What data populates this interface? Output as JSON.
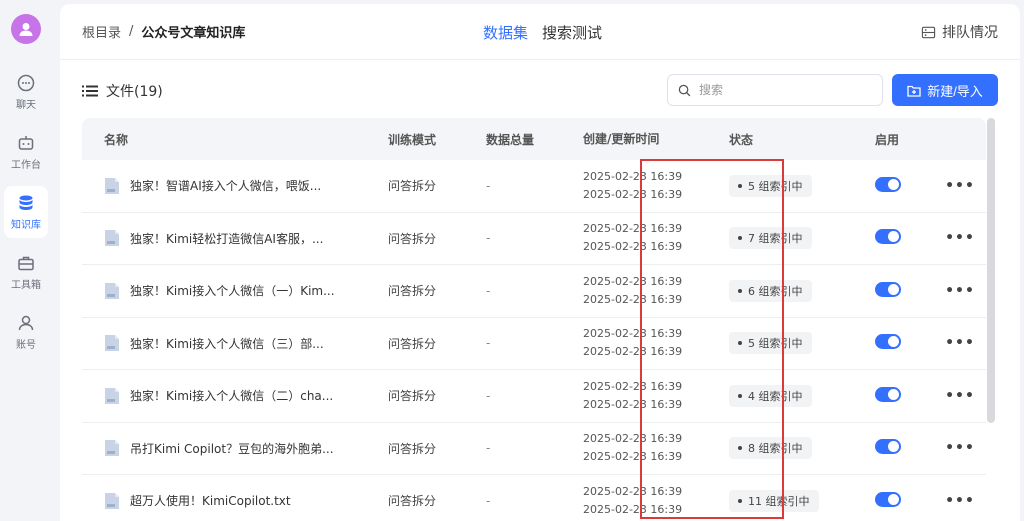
{
  "sidebar": {
    "items": [
      {
        "label": "聊天",
        "icon": "chat-icon",
        "active": false
      },
      {
        "label": "工作台",
        "icon": "robot-icon",
        "active": false
      },
      {
        "label": "知识库",
        "icon": "database-icon",
        "active": true
      },
      {
        "label": "工具箱",
        "icon": "toolbox-icon",
        "active": false
      },
      {
        "label": "账号",
        "icon": "user-icon",
        "active": false
      }
    ]
  },
  "breadcrumb": {
    "root": "根目录",
    "separator": "/",
    "current": "公众号文章知识库"
  },
  "tabs": [
    {
      "label": "数据集",
      "active": true
    },
    {
      "label": "搜索测试",
      "active": false
    }
  ],
  "queue_label": "排队情况",
  "files_title": "文件(19)",
  "search": {
    "placeholder": "搜索"
  },
  "new_button": "新建/导入",
  "table": {
    "headers": {
      "name": "名称",
      "mode": "训练模式",
      "total": "数据总量",
      "time": "创建/更新时间",
      "status": "状态",
      "enable": "启用"
    },
    "rows": [
      {
        "name": "独家！智谱AI接入个人微信，喂饭...",
        "mode": "问答拆分",
        "total": "-",
        "created": "2025-02-23 16:39",
        "updated": "2025-02-23 16:39",
        "status": "5 组索引中",
        "enabled": true
      },
      {
        "name": "独家！Kimi轻松打造微信AI客服，...",
        "mode": "问答拆分",
        "total": "-",
        "created": "2025-02-23 16:39",
        "updated": "2025-02-23 16:39",
        "status": "7 组索引中",
        "enabled": true
      },
      {
        "name": "独家！Kimi接入个人微信（一）Kim...",
        "mode": "问答拆分",
        "total": "-",
        "created": "2025-02-23 16:39",
        "updated": "2025-02-23 16:39",
        "status": "6 组索引中",
        "enabled": true
      },
      {
        "name": "独家！Kimi接入个人微信（三）部...",
        "mode": "问答拆分",
        "total": "-",
        "created": "2025-02-23 16:39",
        "updated": "2025-02-23 16:39",
        "status": "5 组索引中",
        "enabled": true
      },
      {
        "name": "独家！Kimi接入个人微信（二）cha...",
        "mode": "问答拆分",
        "total": "-",
        "created": "2025-02-23 16:39",
        "updated": "2025-02-23 16:39",
        "status": "4 组索引中",
        "enabled": true
      },
      {
        "name": "吊打Kimi Copilot？豆包的海外胞弟...",
        "mode": "问答拆分",
        "total": "-",
        "created": "2025-02-23 16:39",
        "updated": "2025-02-23 16:39",
        "status": "8 组索引中",
        "enabled": true
      },
      {
        "name": "超万人使用！KimiCopilot.txt",
        "mode": "问答拆分",
        "total": "-",
        "created": "2025-02-23 16:39",
        "updated": "2025-02-23 16:39",
        "status": "11 组索引中",
        "enabled": true
      }
    ]
  },
  "colors": {
    "accent": "#3370ff",
    "highlight": "#d93a3a",
    "avatar": "#c774e8"
  }
}
